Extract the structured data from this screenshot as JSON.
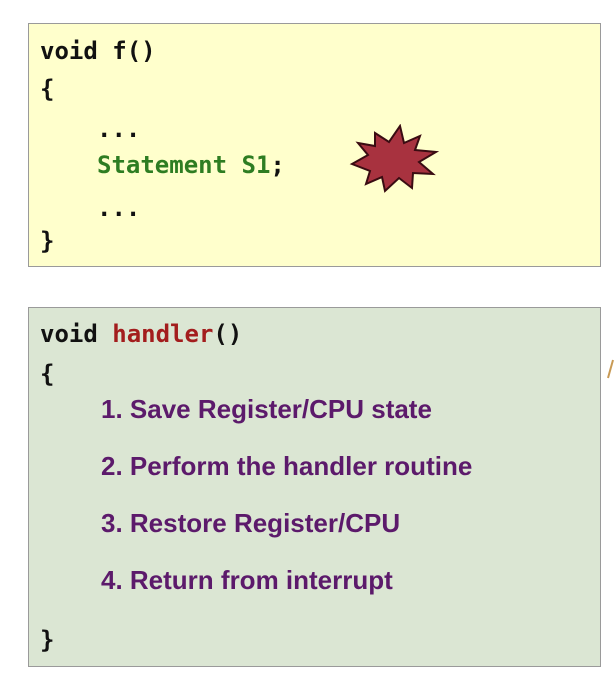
{
  "function_f": {
    "signature": "void f()",
    "open_brace": "{",
    "ellipsis_before": "...",
    "statement": "Statement S1",
    "semicolon": ";",
    "ellipsis_after": "...",
    "close_brace": "}"
  },
  "handler": {
    "keyword": "void ",
    "name": "handler",
    "parens": "()",
    "open_brace": "{",
    "steps": [
      "1. Save Register/CPU state",
      "2. Perform the handler routine",
      "3. Restore Register/CPU",
      "4. Return from interrupt"
    ],
    "close_brace": "}"
  },
  "colors": {
    "top_box_bg": "#ffffcc",
    "bottom_box_bg": "#dbe6d3",
    "statement_green": "#2e7d22",
    "handler_red": "#a31d1d",
    "steps_purple": "#5c1a6b",
    "burst_fill": "#a8323f"
  },
  "icons": {
    "interrupt_marker": "explosion-burst-icon"
  }
}
